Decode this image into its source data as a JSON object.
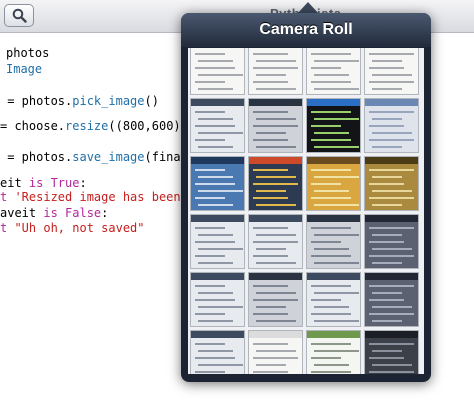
{
  "editor": {
    "title": "Pythonista",
    "lines": [
      {
        "kind": "import",
        "indent": "",
        "parts": [
          {
            "t": "photos",
            "c": ""
          }
        ]
      },
      {
        "kind": "import",
        "indent": "",
        "parts": [
          {
            "t": "Image",
            "c": "fn"
          }
        ]
      },
      {
        "kind": "blank"
      },
      {
        "kind": "code",
        "parts": [
          {
            "t": " = photos.",
            "c": ""
          },
          {
            "t": "pick_image",
            "c": "fn"
          },
          {
            "t": "()",
            "c": ""
          }
        ]
      },
      {
        "kind": "blank"
      },
      {
        "kind": "code",
        "parts": [
          {
            "t": "= choose.",
            "c": ""
          },
          {
            "t": "resize",
            "c": "fn"
          },
          {
            "t": "((800,600),",
            "c": ""
          },
          {
            "t": "Im",
            "c": "fn"
          }
        ]
      },
      {
        "kind": "blank"
      },
      {
        "kind": "code",
        "parts": [
          {
            "t": " = photos.",
            "c": ""
          },
          {
            "t": "save_image",
            "c": "fn"
          },
          {
            "t": "(final)",
            "c": ""
          }
        ]
      },
      {
        "kind": "code",
        "parts": [
          {
            "t": "eit ",
            "c": ""
          },
          {
            "t": "is True",
            "c": "kw"
          },
          {
            "t": ":",
            "c": ""
          }
        ]
      },
      {
        "kind": "code",
        "parts": [
          {
            "t": "t ",
            "c": "kw"
          },
          {
            "t": "'Resized image has been sa",
            "c": "str"
          }
        ]
      },
      {
        "kind": "code",
        "parts": [
          {
            "t": "aveit ",
            "c": ""
          },
          {
            "t": "is False",
            "c": "kw"
          },
          {
            "t": ":",
            "c": ""
          }
        ]
      },
      {
        "kind": "code",
        "parts": [
          {
            "t": "t ",
            "c": "kw"
          },
          {
            "t": "\"Uh oh, not saved\"",
            "c": "str"
          }
        ]
      }
    ]
  },
  "popover": {
    "title": "Camera Roll",
    "thumbnails": [
      {
        "row": 0,
        "col": 0,
        "style": "doc"
      },
      {
        "row": 0,
        "col": 1,
        "style": "doc"
      },
      {
        "row": 0,
        "col": 2,
        "style": "doc"
      },
      {
        "row": 0,
        "col": 3,
        "style": "doc"
      },
      {
        "row": 1,
        "col": 0,
        "style": "app-light"
      },
      {
        "row": 1,
        "col": 1,
        "style": "app-gray"
      },
      {
        "row": 1,
        "col": 2,
        "style": "dark-art"
      },
      {
        "row": 1,
        "col": 3,
        "style": "settings"
      },
      {
        "row": 2,
        "col": 0,
        "style": "home-blue"
      },
      {
        "row": 2,
        "col": 1,
        "style": "icons"
      },
      {
        "row": 2,
        "col": 2,
        "style": "game"
      },
      {
        "row": 2,
        "col": 3,
        "style": "game-gold"
      },
      {
        "row": 3,
        "col": 0,
        "style": "app-light"
      },
      {
        "row": 3,
        "col": 1,
        "style": "app-light"
      },
      {
        "row": 3,
        "col": 2,
        "style": "app-gray"
      },
      {
        "row": 3,
        "col": 3,
        "style": "app-dark"
      },
      {
        "row": 4,
        "col": 0,
        "style": "app-light"
      },
      {
        "row": 4,
        "col": 1,
        "style": "app-gray"
      },
      {
        "row": 4,
        "col": 2,
        "style": "app-light"
      },
      {
        "row": 4,
        "col": 3,
        "style": "app-dark"
      },
      {
        "row": 5,
        "col": 0,
        "style": "app-light"
      },
      {
        "row": 5,
        "col": 1,
        "style": "doc"
      },
      {
        "row": 5,
        "col": 2,
        "style": "doc-green"
      },
      {
        "row": 5,
        "col": 3,
        "style": "dark-ui"
      }
    ]
  }
}
